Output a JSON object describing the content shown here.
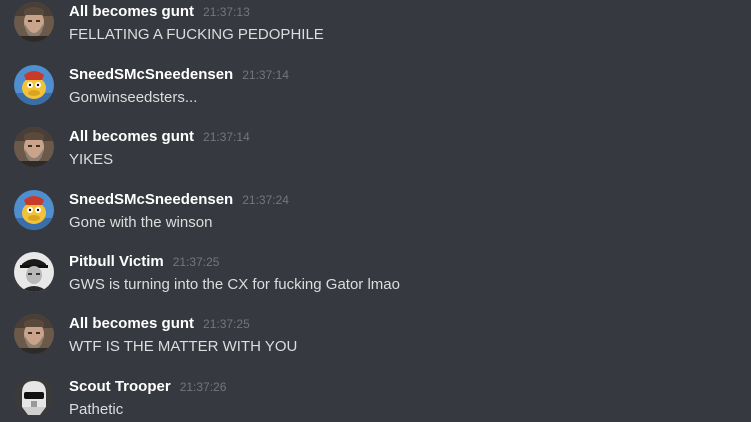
{
  "colors": {
    "background": "#36393f",
    "username": "#ffffff",
    "timestamp": "#72767d",
    "message_text": "#dcddde"
  },
  "messages": [
    {
      "username": "All becomes gunt",
      "time": "21:37:13",
      "text": "FELLATING A FUCKING PEDOPHILE",
      "avatar": "bearded-man-photo"
    },
    {
      "username": "SneedSMcSneedensen",
      "time": "21:37:14",
      "text": "Gonwinseedsters...",
      "avatar": "cartoon-character"
    },
    {
      "username": "All becomes gunt",
      "time": "21:37:14",
      "text": "YIKES",
      "avatar": "bearded-man-photo"
    },
    {
      "username": "SneedSMcSneedensen",
      "time": "21:37:24",
      "text": "Gone with the winson",
      "avatar": "cartoon-character"
    },
    {
      "username": "Pitbull Victim",
      "time": "21:37:25",
      "text": "GWS is turning into the CX for fucking Gator lmao",
      "avatar": "black-white-portrait"
    },
    {
      "username": "All becomes gunt",
      "time": "21:37:25",
      "text": "WTF IS THE MATTER WITH YOU",
      "avatar": "bearded-man-photo"
    },
    {
      "username": "Scout Trooper",
      "time": "21:37:26",
      "text": "Pathetic",
      "avatar": "scout-trooper-helmet"
    }
  ]
}
